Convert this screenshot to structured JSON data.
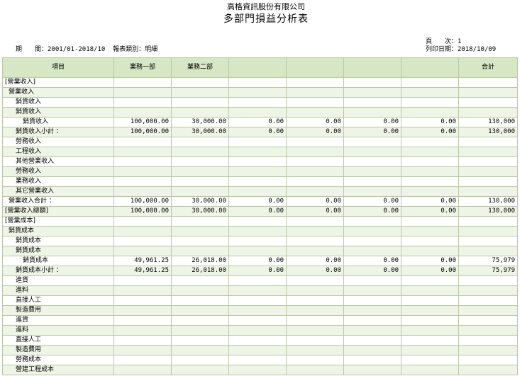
{
  "company": "高格資訊股份有限公司",
  "title": "多部門損益分析表",
  "meta": {
    "period_label": "期　　間：",
    "period_value": "2001/01-2018/10",
    "type_label": "報表類別：",
    "type_value": "明細",
    "page_label": "頁　　次：",
    "page_value": "1",
    "print_label": "列印日期：",
    "print_value": "2018/10/09"
  },
  "columns": [
    "項目",
    "業務一部",
    "業務二部",
    "",
    "",
    "",
    "",
    "合計"
  ],
  "rows": [
    {
      "indent": 0,
      "label": "[營業收入]",
      "values": [
        "",
        "",
        "",
        "",
        "",
        "",
        ""
      ]
    },
    {
      "indent": 1,
      "label": "營業收入",
      "values": [
        "",
        "",
        "",
        "",
        "",
        "",
        ""
      ]
    },
    {
      "indent": 2,
      "label": "銷貨收入",
      "values": [
        "",
        "",
        "",
        "",
        "",
        "",
        ""
      ]
    },
    {
      "indent": 2,
      "label": "銷貨收入",
      "values": [
        "",
        "",
        "",
        "",
        "",
        "",
        ""
      ]
    },
    {
      "indent": 3,
      "label": "銷貨收入",
      "values": [
        "100,000.00",
        "30,000.00",
        "0.00",
        "0.00",
        "0.00",
        "0.00",
        "130,000"
      ]
    },
    {
      "indent": 2,
      "label": "銷貨收入小計 ：",
      "values": [
        "100,000.00",
        "30,000.00",
        "0.00",
        "0.00",
        "0.00",
        "0.00",
        "130,000"
      ]
    },
    {
      "indent": 2,
      "label": "勞務收入",
      "values": [
        "",
        "",
        "",
        "",
        "",
        "",
        ""
      ]
    },
    {
      "indent": 2,
      "label": "工程收入",
      "values": [
        "",
        "",
        "",
        "",
        "",
        "",
        ""
      ]
    },
    {
      "indent": 2,
      "label": "其他營業收入",
      "values": [
        "",
        "",
        "",
        "",
        "",
        "",
        ""
      ]
    },
    {
      "indent": 2,
      "label": "勞務收入",
      "values": [
        "",
        "",
        "",
        "",
        "",
        "",
        ""
      ]
    },
    {
      "indent": 2,
      "label": "業務收入",
      "values": [
        "",
        "",
        "",
        "",
        "",
        "",
        ""
      ]
    },
    {
      "indent": 2,
      "label": "其它營業收入",
      "values": [
        "",
        "",
        "",
        "",
        "",
        "",
        ""
      ]
    },
    {
      "indent": 1,
      "label": "營業收入合計 ：",
      "values": [
        "100,000.00",
        "30,000.00",
        "0.00",
        "0.00",
        "0.00",
        "0.00",
        "130,000"
      ]
    },
    {
      "indent": 0,
      "label": "[營業收入總額]",
      "values": [
        "100,000.00",
        "30,000.00",
        "0.00",
        "0.00",
        "0.00",
        "0.00",
        "130,000"
      ]
    },
    {
      "indent": 0,
      "label": "[營業成本]",
      "values": [
        "",
        "",
        "",
        "",
        "",
        "",
        ""
      ]
    },
    {
      "indent": 1,
      "label": "銷貨成本",
      "values": [
        "",
        "",
        "",
        "",
        "",
        "",
        ""
      ]
    },
    {
      "indent": 2,
      "label": "銷貨成本",
      "values": [
        "",
        "",
        "",
        "",
        "",
        "",
        ""
      ]
    },
    {
      "indent": 2,
      "label": "銷貨成本",
      "values": [
        "",
        "",
        "",
        "",
        "",
        "",
        ""
      ]
    },
    {
      "indent": 3,
      "label": "銷貨成本",
      "values": [
        "49,961.25",
        "26,018.00",
        "0.00",
        "0.00",
        "0.00",
        "0.00",
        "75,979"
      ]
    },
    {
      "indent": 2,
      "label": "銷貨成本小計 ：",
      "values": [
        "49,961.25",
        "26,018.00",
        "0.00",
        "0.00",
        "0.00",
        "0.00",
        "75,979"
      ]
    },
    {
      "indent": 2,
      "label": "進貨",
      "values": [
        "",
        "",
        "",
        "",
        "",
        "",
        ""
      ]
    },
    {
      "indent": 2,
      "label": "進料",
      "values": [
        "",
        "",
        "",
        "",
        "",
        "",
        ""
      ]
    },
    {
      "indent": 2,
      "label": "直接人工",
      "values": [
        "",
        "",
        "",
        "",
        "",
        "",
        ""
      ]
    },
    {
      "indent": 2,
      "label": "製造費用",
      "values": [
        "",
        "",
        "",
        "",
        "",
        "",
        ""
      ]
    },
    {
      "indent": 2,
      "label": "進貨",
      "values": [
        "",
        "",
        "",
        "",
        "",
        "",
        ""
      ]
    },
    {
      "indent": 2,
      "label": "進料",
      "values": [
        "",
        "",
        "",
        "",
        "",
        "",
        ""
      ]
    },
    {
      "indent": 2,
      "label": "直接人工",
      "values": [
        "",
        "",
        "",
        "",
        "",
        "",
        ""
      ]
    },
    {
      "indent": 2,
      "label": "製造費用",
      "values": [
        "",
        "",
        "",
        "",
        "",
        "",
        ""
      ]
    },
    {
      "indent": 2,
      "label": "勞務成本",
      "values": [
        "",
        "",
        "",
        "",
        "",
        "",
        ""
      ]
    },
    {
      "indent": 2,
      "label": "營建工程成本",
      "values": [
        "",
        "",
        "",
        "",
        "",
        "",
        ""
      ]
    }
  ]
}
